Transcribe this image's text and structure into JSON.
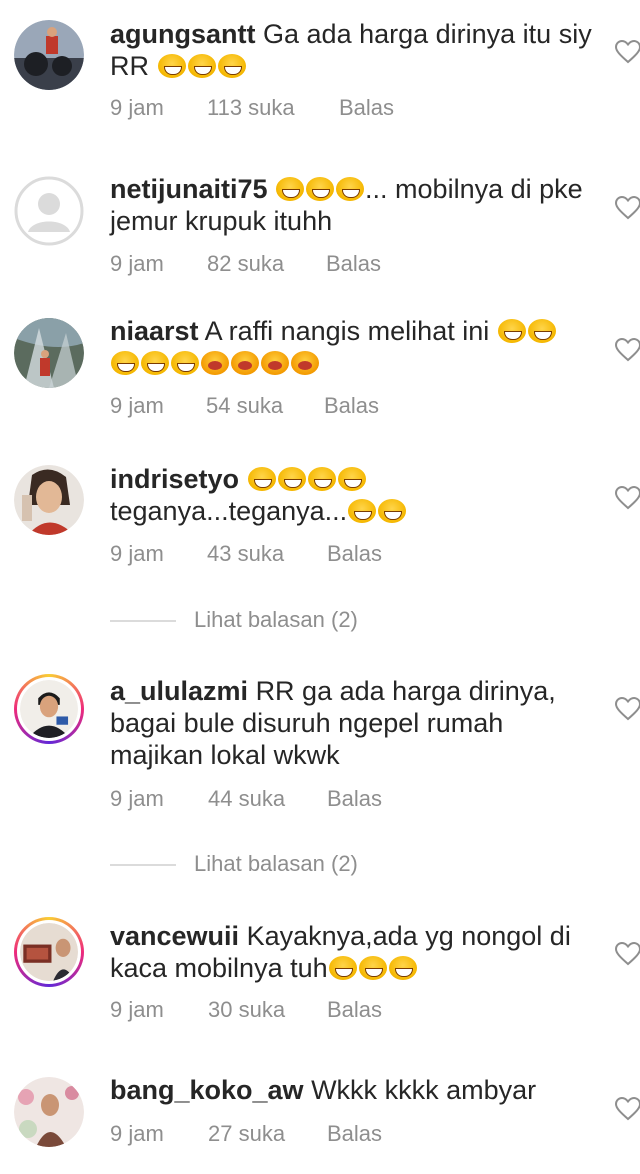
{
  "comments": [
    {
      "username": "agungsantt",
      "text": "Ga ada harga dirinya itu siy RR",
      "line2": "",
      "emoji_after": 3,
      "time": "9 jam",
      "likes": "113 suka",
      "reply": "Balas"
    },
    {
      "username": "netijunaiti75",
      "text": "... mobilnya di pke",
      "line2": "jemur krupuk ituhh",
      "emoji_before": 3,
      "time": "9 jam",
      "likes": "82 suka",
      "reply": "Balas"
    },
    {
      "username": "niaarst",
      "text": "A raffi nangis melihat ini",
      "time": "9 jam",
      "likes": "54 suka",
      "reply": "Balas"
    },
    {
      "username": "indrisetyo",
      "line2": "teganya...teganya...",
      "time": "9 jam",
      "likes": "43 suka",
      "reply": "Balas",
      "view_replies": "Lihat balasan (2)"
    },
    {
      "username": "a_ululazmi",
      "text": "RR ga ada harga dirinya,",
      "line2": "bagai bule disuruh ngepel rumah",
      "line3": "majikan lokal wkwk",
      "time": "9 jam",
      "likes": "44 suka",
      "reply": "Balas",
      "view_replies": "Lihat balasan (2)"
    },
    {
      "username": "vancewuii",
      "text": "Kayaknya,ada yg nongol di",
      "line2": "kaca mobilnya tuh",
      "time": "9 jam",
      "likes": "30 suka",
      "reply": "Balas"
    },
    {
      "username": "bang_koko_aw",
      "text": "Wkkk kkkk ambyar",
      "time": "9 jam",
      "likes": "27 suka",
      "reply": "Balas"
    }
  ],
  "icons": {
    "like": "heart-outline-icon",
    "emoji_laugh": "tears-of-joy-emoji",
    "emoji_cry": "loudly-crying-emoji"
  },
  "colors": {
    "text": "#262626",
    "meta": "#8e8e8e",
    "divider": "#dbdbdb"
  }
}
